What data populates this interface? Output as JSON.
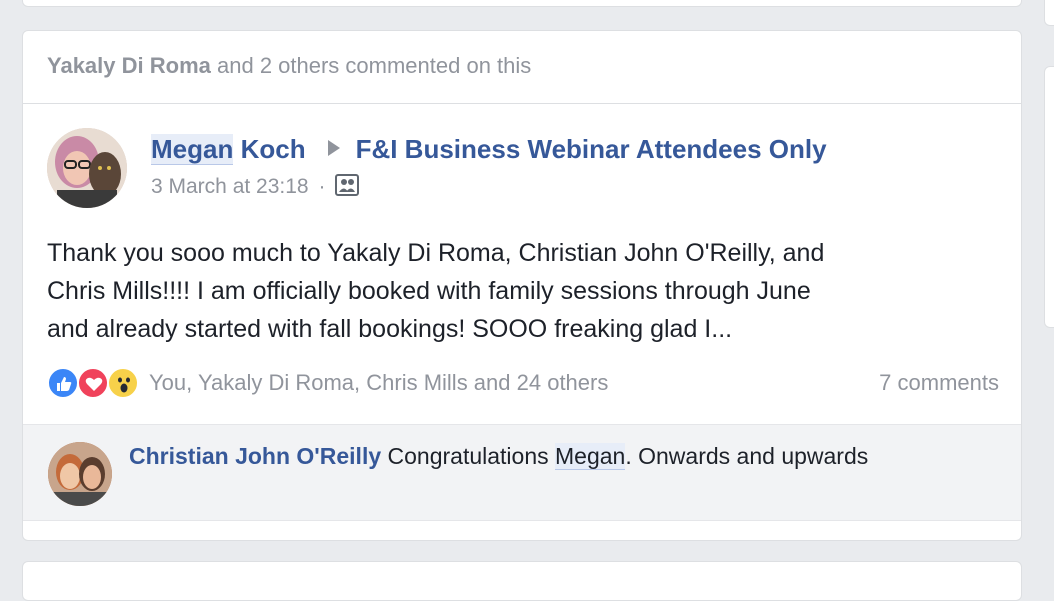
{
  "activity": {
    "actor": "Yakaly Di Roma",
    "rest": "and 2 others commented on this"
  },
  "post": {
    "author_first": "Megan",
    "author_last": "Koch",
    "group": "F&I Business Webinar Attendees Only",
    "timestamp": "3 March at 23:18",
    "separator": "·",
    "text_line1": "Thank you sooo much to Yakaly Di Roma, Christian John O'Reilly, and",
    "text_line2": "Chris Mills!!!! I am officially booked with family sessions through June",
    "text_line3": "and already started with fall bookings! SOOO freaking glad I..."
  },
  "reactions": {
    "names": "You, Yakaly Di Roma, Chris Mills and 24 others",
    "comments": "7 comments",
    "icons": [
      "like-icon",
      "love-icon",
      "wow-icon"
    ]
  },
  "comment": {
    "author": "Christian John O'Reilly",
    "text_before": "Congratulations",
    "mention": "Megan",
    "text_after": ". Onwards and upwards"
  },
  "colors": {
    "link": "#365899",
    "muted": "#90949c",
    "page_bg": "#e9ebee"
  }
}
